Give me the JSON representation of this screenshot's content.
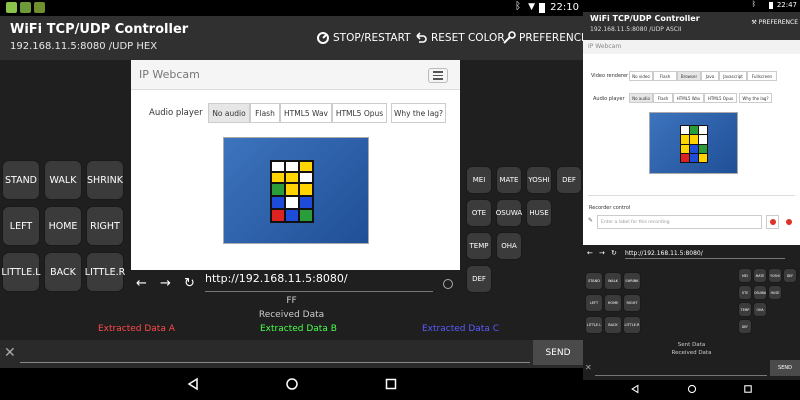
{
  "left": {
    "status_time": "22:10",
    "title": "WiFi TCP/UDP Controller",
    "subtitle": "192.168.11.5:8080 /UDP  HEX",
    "actions": {
      "stop_restart": "STOP/RESTART",
      "reset_color": "RESET COLOR",
      "preference": "PREFERENCE"
    },
    "pad": {
      "stand": "STAND",
      "walk": "WALK",
      "shrink": "SHRINK",
      "left": "LEFT",
      "home": "HOME",
      "right": "RIGHT",
      "little_l": "LITTLE.L",
      "back": "BACK",
      "little_r": "LITTLE.R"
    },
    "right_pad": {
      "mei": "MEI",
      "mate": "MATE",
      "yoshi": "YOSHI",
      "def1": "DEF",
      "ote": "OTE",
      "osuwa": "OSUWA",
      "huse": "HUSE",
      "temp": "TEMP",
      "oha": "OHA",
      "def2": "DEF"
    },
    "webview": {
      "title": "IP Webcam",
      "audio_label": "Audio player",
      "audio_options": [
        "No audio",
        "Flash",
        "HTML5 Wav",
        "HTML5 Opus",
        "Why the lag?"
      ]
    },
    "url": "http://192.168.11.5:8080/",
    "received_value": "FF",
    "received_label": "Received Data",
    "extract_a": "Extracted Data A",
    "extract_b": "Extracted Data B",
    "extract_c": "Extracted Data C",
    "send_label": "SEND"
  },
  "right": {
    "status_time": "22:47",
    "title": "WiFi TCP/UDP Controller",
    "subtitle": "192.168.11.5:8080 /UDP  ASCII",
    "preference": "PREFERENCE",
    "webview": {
      "title": "IP Webcam",
      "video_label": "Video renderer",
      "video_options": [
        "No video",
        "Flash",
        "Browser",
        "Java",
        "Javascript",
        "Fullscreen"
      ],
      "audio_label": "Audio player",
      "audio_options": [
        "No audio",
        "Flash",
        "HTML5 Wav",
        "HTML5 Opus",
        "Why the lag?"
      ],
      "recorder_label": "Recorder control",
      "recorder_placeholder": "Enter a label for this recording"
    },
    "url": "http://192.168.11.5:8080/",
    "pad": [
      "STAND",
      "WALK",
      "SHRINK",
      "LEFT",
      "HOME",
      "RIGHT",
      "LITTLE.L",
      "BACK",
      "LITTLE.R"
    ],
    "right_pad": [
      "MEI",
      "MATE",
      "YOSHI",
      "DEF",
      "OTE",
      "OSUWA",
      "HUSE",
      "TEMP",
      "OHA",
      "DEF"
    ],
    "sent_label": "Sent Data",
    "received_label": "Received Data",
    "send_label": "SEND"
  },
  "colors": {
    "extract_a": "#ff4a4a",
    "extract_b": "#4aff4a",
    "extract_c": "#5a5aff"
  }
}
